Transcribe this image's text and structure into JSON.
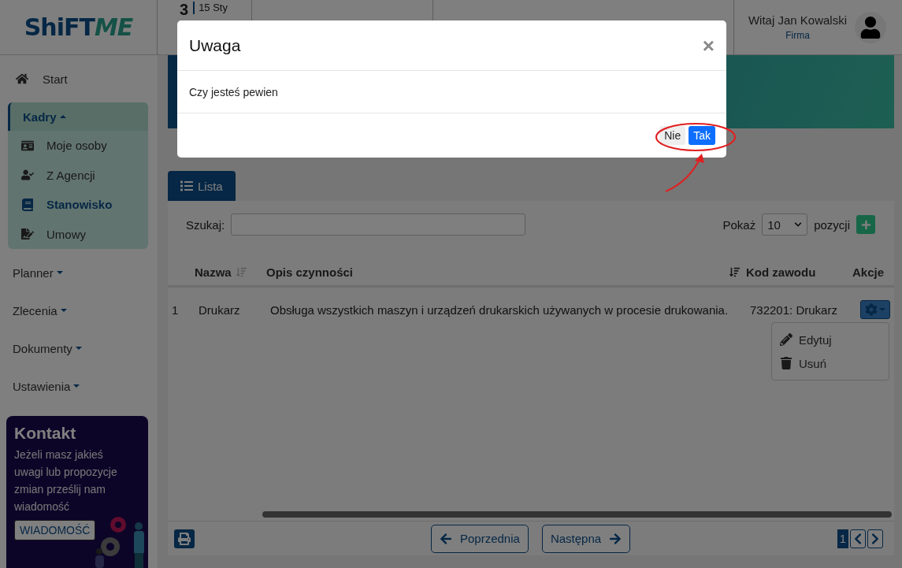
{
  "header": {
    "logo_main": "ShiFT",
    "logo_accent": "ME",
    "day": "3",
    "date": "15 Sty",
    "greeting": "Witaj Jan Kowalski",
    "company": "Firma"
  },
  "sidebar": {
    "start": {
      "label": "Start"
    },
    "groups": [
      {
        "label": "Kadry",
        "expanded": true,
        "children": [
          {
            "label": "Moje osoby",
            "selected": false
          },
          {
            "label": "Z Agencji",
            "selected": false
          },
          {
            "label": "Stanowisko",
            "selected": true
          },
          {
            "label": "Umowy",
            "selected": false
          }
        ]
      },
      {
        "label": "Planner",
        "expanded": false
      },
      {
        "label": "Zlecenia",
        "expanded": false
      },
      {
        "label": "Dokumenty",
        "expanded": false
      },
      {
        "label": "Ustawienia",
        "expanded": false
      }
    ],
    "contact": {
      "title": "Kontakt",
      "text": "Jeżeli masz jakieś uwagi lub propozycje zmian prześlij nam wiadomość",
      "button": "WIADOMOŚĆ"
    }
  },
  "tabs": [
    {
      "label": "Lista",
      "selected": true
    }
  ],
  "toolbar": {
    "search_label": "Szukaj:",
    "show_label": "Pokaż",
    "page_size": "10",
    "page_size_suffix": "pozycji"
  },
  "table": {
    "columns": [
      {
        "label": "Nazwa",
        "sorted": false
      },
      {
        "label": "Opis czynności",
        "sorted": true
      },
      {
        "label": "Kod zawodu"
      },
      {
        "label": "Akcje"
      }
    ],
    "rows": [
      {
        "index": "1",
        "name": "Drukarz",
        "description": "Obsługa wszystkich maszyn i urządzeń drukarskich używanych w procesie drukowania.",
        "code": "732201: Drukarz",
        "menu_expanded": true
      }
    ],
    "actions_menu": [
      {
        "label": "Edytuj",
        "kind": "edit"
      },
      {
        "label": "Usuń",
        "kind": "delete"
      }
    ]
  },
  "pagination": {
    "previous": "Poprzednia",
    "next": "Następna",
    "pages": [
      {
        "label": "1",
        "selected": true
      }
    ]
  },
  "modal": {
    "title": "Uwaga",
    "close": "×",
    "message": "Czy jesteś pewien",
    "buttons": [
      {
        "label": "Nie",
        "kind": "secondary"
      },
      {
        "label": "Tak",
        "kind": "primary"
      }
    ]
  },
  "annotation": {
    "highlight": true
  }
}
